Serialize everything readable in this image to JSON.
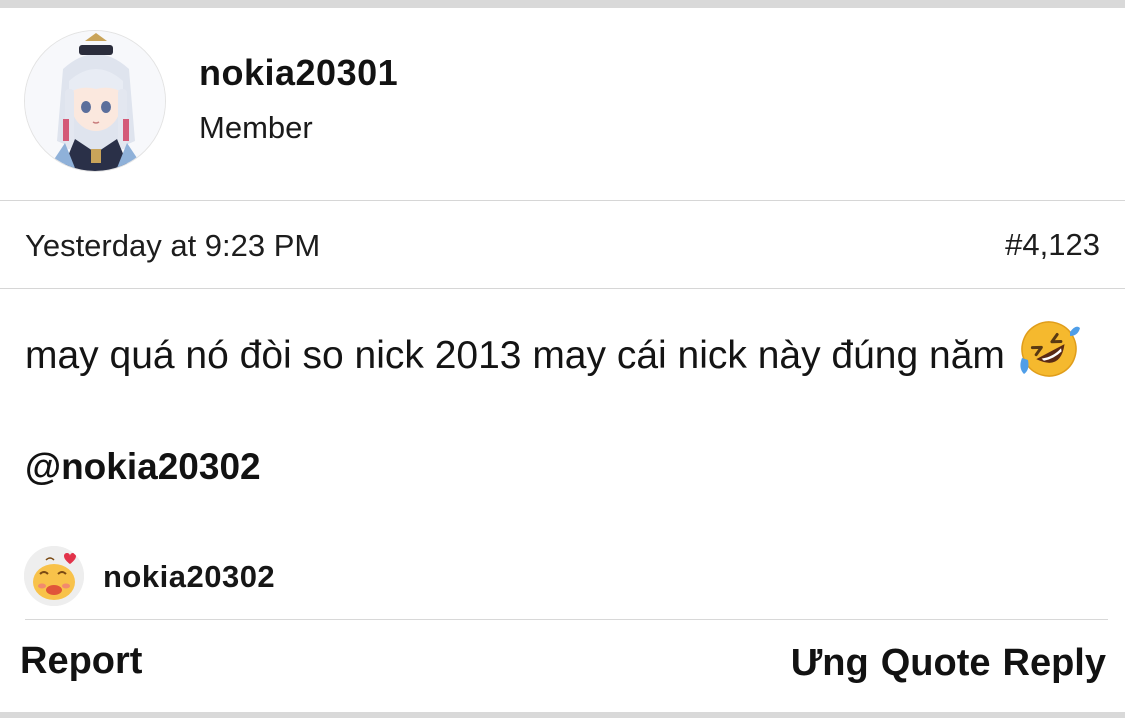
{
  "post": {
    "author": {
      "username": "nokia20301",
      "role": "Member",
      "avatar_icon": "anime-character-avatar"
    },
    "timestamp": "Yesterday at 9:23 PM",
    "number": "#4,123",
    "content": {
      "text": "may quá nó đòi so nick 2013 may cái nick này đúng năm",
      "emoji": "rolling-on-floor-laughing-emoji",
      "mention": "@nokia20302"
    },
    "reactions": [
      {
        "username": "nokia20302",
        "icon": "smiling-face-with-hearts-emoji"
      }
    ],
    "actions": {
      "report": "Report",
      "like": "Ưng",
      "quote": "Quote",
      "reply": "Reply"
    }
  },
  "colors": {
    "background": "#ffffff",
    "text": "#141414",
    "divider": "#d6d6d6",
    "frame_bar": "#d9d9d9"
  }
}
